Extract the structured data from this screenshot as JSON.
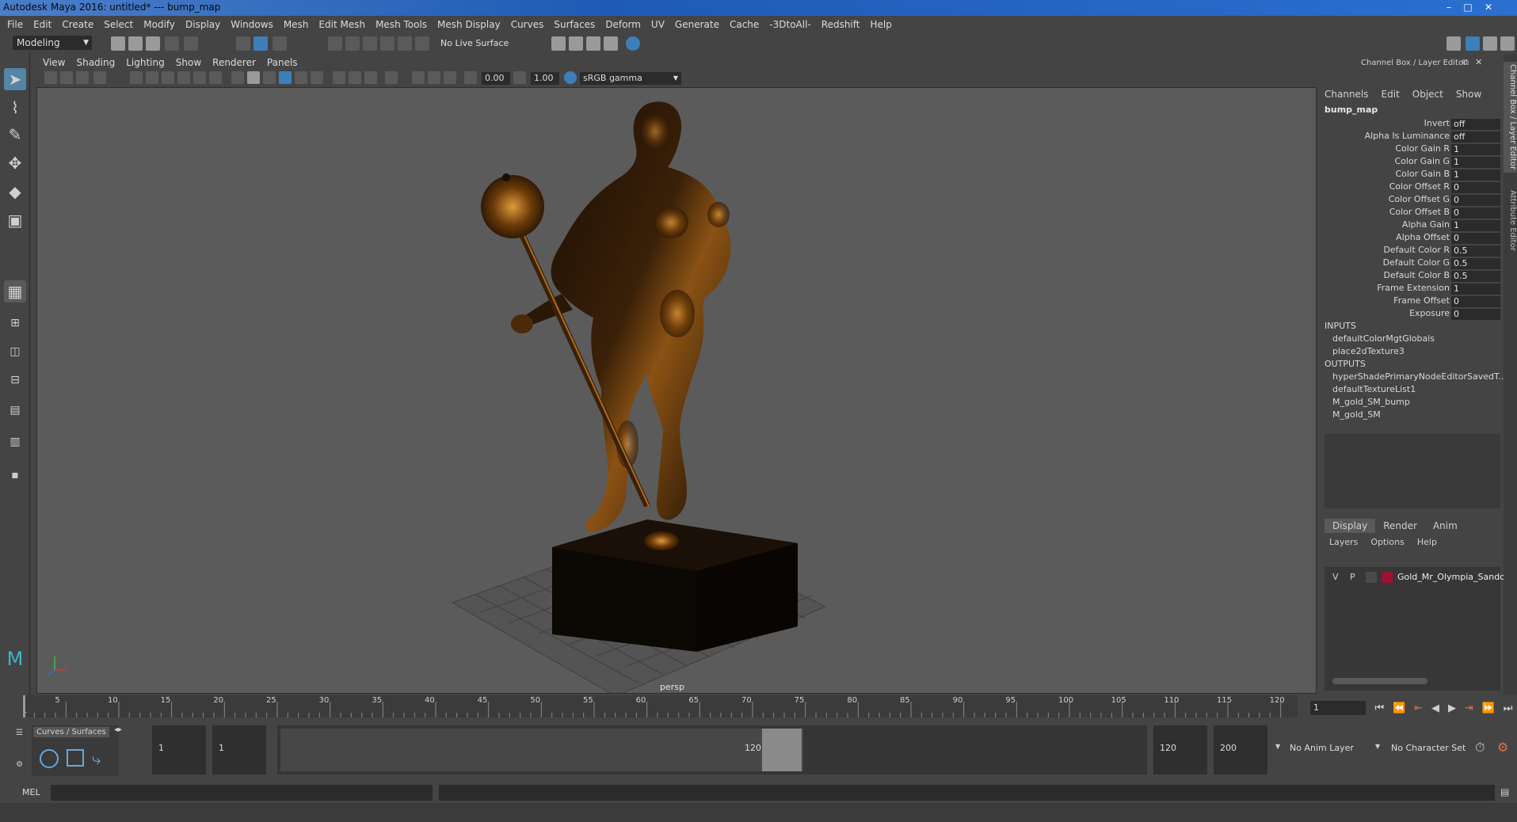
{
  "window": {
    "title": "Autodesk Maya 2016: untitled*   ---   bump_map",
    "minimize": "–",
    "maximize": "□",
    "close": "✕"
  },
  "menus": [
    "File",
    "Edit",
    "Create",
    "Select",
    "Modify",
    "Display",
    "Windows",
    "Mesh",
    "Edit Mesh",
    "Mesh Tools",
    "Mesh Display",
    "Curves",
    "Surfaces",
    "Deform",
    "UV",
    "Generate",
    "Cache",
    "-3DtoAll-",
    "Redshift",
    "Help"
  ],
  "status": {
    "mode": "Modeling",
    "live_surface": "No Live Surface"
  },
  "viewport": {
    "menus": [
      "View",
      "Shading",
      "Lighting",
      "Show",
      "Renderer",
      "Panels"
    ],
    "exposure": "0.00",
    "gamma": "1.00",
    "color_space": "sRGB gamma",
    "camera_label": "persp"
  },
  "channel_box": {
    "header": "Channel Box / Layer Editor",
    "menus": [
      "Channels",
      "Edit",
      "Object",
      "Show"
    ],
    "node": "bump_map",
    "attributes": [
      {
        "label": "Invert",
        "value": "off"
      },
      {
        "label": "Alpha Is Luminance",
        "value": "off"
      },
      {
        "label": "Color Gain R",
        "value": "1"
      },
      {
        "label": "Color Gain G",
        "value": "1"
      },
      {
        "label": "Color Gain B",
        "value": "1"
      },
      {
        "label": "Color Offset R",
        "value": "0"
      },
      {
        "label": "Color Offset G",
        "value": "0"
      },
      {
        "label": "Color Offset B",
        "value": "0"
      },
      {
        "label": "Alpha Gain",
        "value": "1"
      },
      {
        "label": "Alpha Offset",
        "value": "0"
      },
      {
        "label": "Default Color R",
        "value": "0.5"
      },
      {
        "label": "Default Color G",
        "value": "0.5"
      },
      {
        "label": "Default Color B",
        "value": "0.5"
      },
      {
        "label": "Frame Extension",
        "value": "1"
      },
      {
        "label": "Frame Offset",
        "value": "0"
      },
      {
        "label": "Exposure",
        "value": "0"
      }
    ],
    "inputs_label": "INPUTS",
    "inputs": [
      "defaultColorMgtGlobals",
      "place2dTexture3"
    ],
    "outputs_label": "OUTPUTS",
    "outputs": [
      "hyperShadePrimaryNodeEditorSavedT...",
      "defaultTextureList1",
      "M_gold_SM_bump",
      "M_gold_SM"
    ]
  },
  "layer_editor": {
    "tabs": [
      "Display",
      "Render",
      "Anim"
    ],
    "menus": [
      "Layers",
      "Options",
      "Help"
    ],
    "layer": {
      "v": "V",
      "p": "P",
      "name": "Gold_Mr_Olympia_Sando",
      "color": "#a01030"
    }
  },
  "side_tabs": [
    "Channel Box / Layer Editor",
    "Attribute Editor"
  ],
  "timeline": {
    "ticks": [
      "5",
      "10",
      "15",
      "20",
      "25",
      "30",
      "35",
      "40",
      "45",
      "50",
      "55",
      "60",
      "65",
      "70",
      "75",
      "80",
      "85",
      "90",
      "95",
      "100",
      "105",
      "110",
      "115",
      "120"
    ],
    "start_label": "1",
    "current_frame": "1"
  },
  "range": {
    "shelf_tab": "Curves / Surfaces",
    "start": "1",
    "playback_start": "1",
    "slider_start": "1",
    "slider_end": "120",
    "playback_end": "120",
    "end": "200",
    "anim_layer": "No Anim Layer",
    "character_set": "No Character Set"
  },
  "command": {
    "language": "MEL"
  }
}
